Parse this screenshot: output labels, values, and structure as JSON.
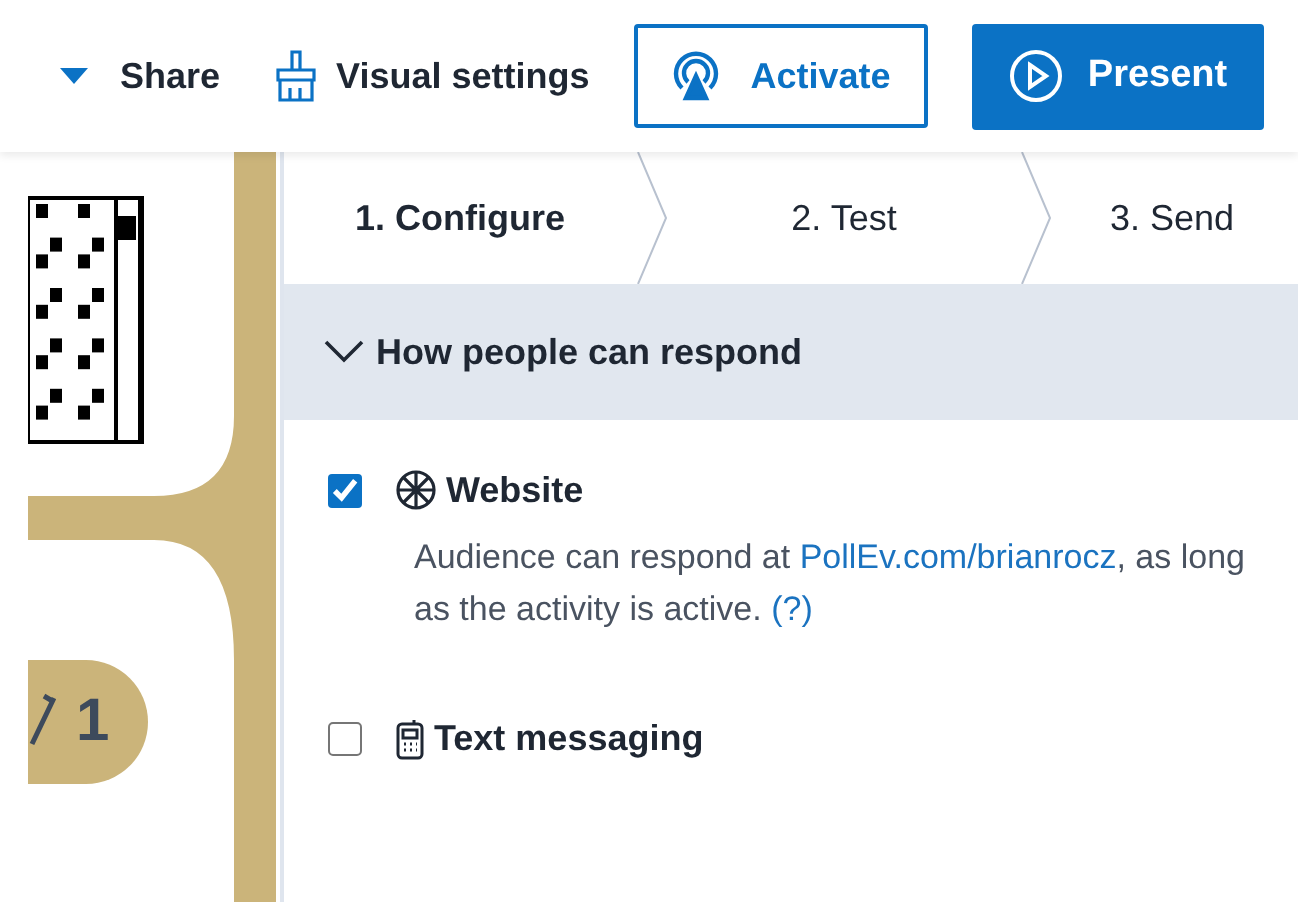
{
  "toolbar": {
    "share": {
      "label": "Share"
    },
    "visual_settings": {
      "label": "Visual settings"
    },
    "activate": {
      "label": "Activate"
    },
    "present": {
      "label": "Present"
    }
  },
  "slide": {
    "badge": "1"
  },
  "steps": [
    {
      "label": "1. Configure",
      "selected": true
    },
    {
      "label": "2. Test",
      "selected": false
    },
    {
      "label": "3. Send",
      "selected": false
    }
  ],
  "section": {
    "title": "How people can respond",
    "expanded": true
  },
  "options": [
    {
      "kind": "website",
      "label": "Website",
      "checked": true,
      "description": "Audience can respond at ",
      "link": "PollEv.com/brianrocz",
      "description_end": ", as long as the activity is active.",
      "help": "(?)"
    },
    {
      "kind": "sms",
      "label": "Text messaging",
      "checked": false
    }
  ]
}
